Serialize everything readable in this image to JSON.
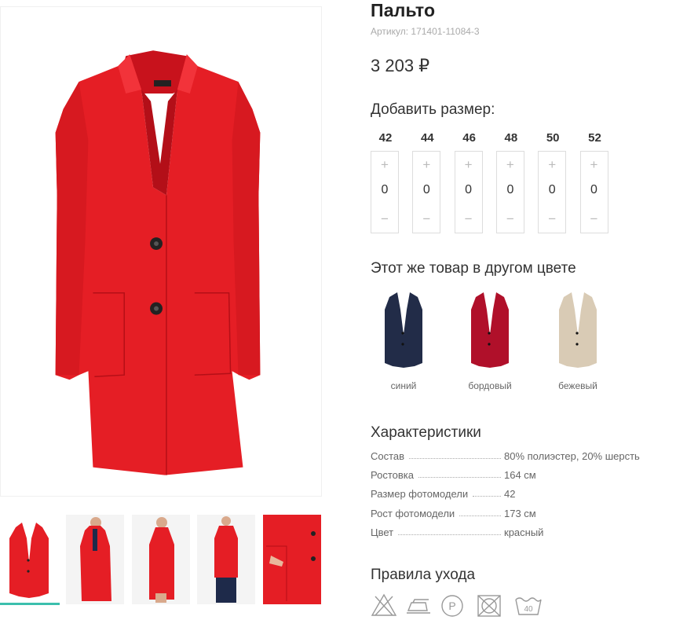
{
  "product": {
    "title": "Пальто",
    "sku": "Артикул: 171401-11084-3",
    "price": "3 203 ₽",
    "main_color": "#e51e25"
  },
  "sizes": {
    "heading": "Добавить размер:",
    "items": [
      {
        "size": "42",
        "qty": "0"
      },
      {
        "size": "44",
        "qty": "0"
      },
      {
        "size": "46",
        "qty": "0"
      },
      {
        "size": "48",
        "qty": "0"
      },
      {
        "size": "50",
        "qty": "0"
      },
      {
        "size": "52",
        "qty": "0"
      }
    ],
    "plus_symbol": "+",
    "minus_symbol": "−"
  },
  "other_colors": {
    "heading": "Этот же товар в другом цвете",
    "items": [
      {
        "name": "синий",
        "color": "#222c48"
      },
      {
        "name": "бордовый",
        "color": "#b0102a"
      },
      {
        "name": "бежевый",
        "color": "#d9cbb5"
      }
    ]
  },
  "specs": {
    "heading": "Характеристики",
    "rows": [
      {
        "key": "Состав",
        "value": "80% полиэстер, 20% шерсть"
      },
      {
        "key": "Ростовка",
        "value": "164 см"
      },
      {
        "key": "Размер фотомодели",
        "value": "42"
      },
      {
        "key": "Рост фотомодели",
        "value": "173 см"
      },
      {
        "key": "Цвет",
        "value": "красный"
      }
    ]
  },
  "care": {
    "heading": "Правила ухода",
    "icons": [
      "no-bleach-icon",
      "iron-icon",
      "dry-clean-p-icon",
      "no-tumble-dry-icon",
      "wash-40-icon"
    ],
    "wash_temp": "40"
  },
  "gallery": {
    "thumbs": [
      "front-flat",
      "model-front",
      "model-side",
      "model-full",
      "pocket-detail"
    ],
    "active_index": 0,
    "accent": "#3bbfad"
  }
}
